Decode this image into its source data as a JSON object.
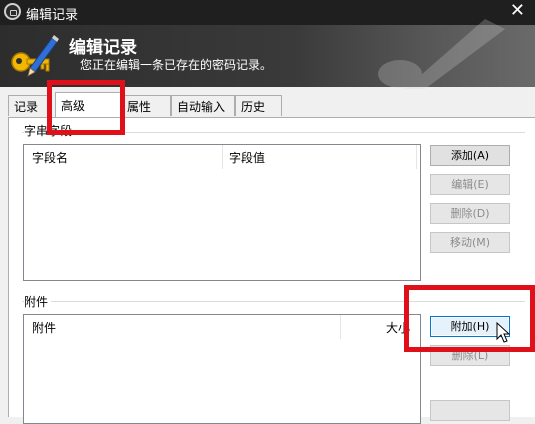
{
  "window": {
    "title": "编辑记录",
    "close_glyph": "✕"
  },
  "header": {
    "title": "编辑记录",
    "subtitle": "您正在编辑一条已存在的密码记录。"
  },
  "tabs": [
    {
      "label": "记录"
    },
    {
      "label": "高级"
    },
    {
      "label": "属性"
    },
    {
      "label": "自动输入"
    },
    {
      "label": "历史"
    }
  ],
  "string_fields": {
    "group_label": "字串字段",
    "columns": [
      "字段名",
      "字段值"
    ],
    "rows": [],
    "buttons": {
      "add": "添加(A)",
      "edit": "编辑(E)",
      "delete": "删除(D)",
      "move": "移动(M)"
    }
  },
  "attachments": {
    "group_label": "附件",
    "columns": [
      "附件",
      "大小"
    ],
    "rows": [],
    "buttons": {
      "attach": "附加(H)",
      "delete": "删除(L)"
    }
  },
  "colors": {
    "titlebar": "#1f1f1f",
    "highlight": "#e0101a",
    "focus": "#0078d7"
  },
  "icons": [
    "app-lock-icon",
    "close-icon",
    "key-pen-icon",
    "mouse-cursor-icon"
  ]
}
